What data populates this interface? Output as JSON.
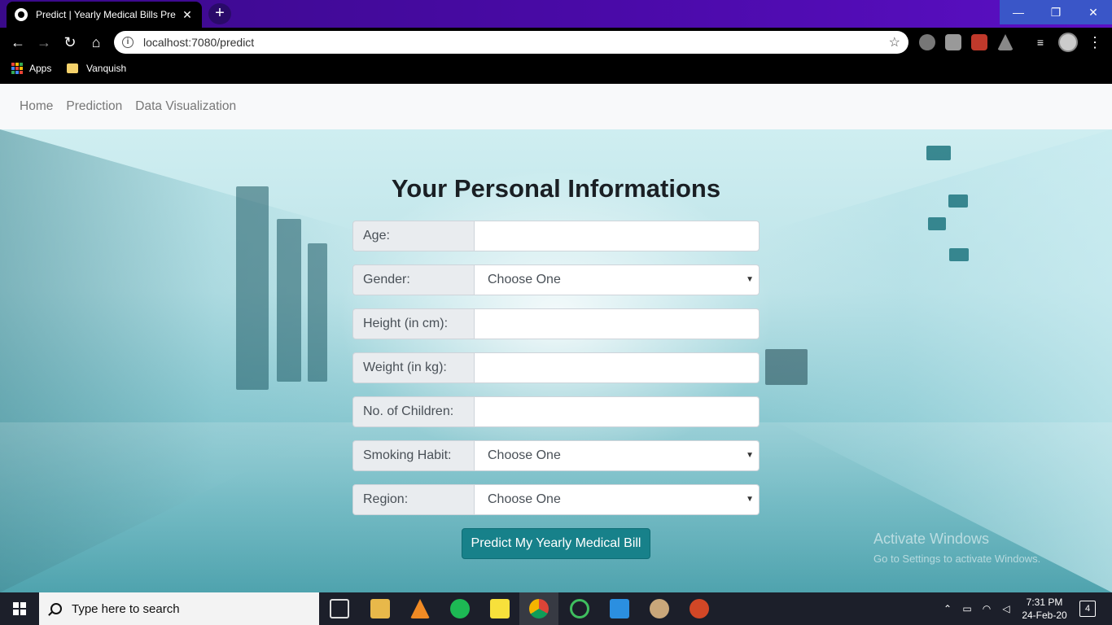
{
  "browser": {
    "tab_title": "Predict | Yearly Medical Bills Prediction",
    "new_tab_label": "+",
    "url": "localhost:7080/predict",
    "bookmarks": [
      "Apps",
      "Vanquish"
    ],
    "window_controls": {
      "minimize": "—",
      "maximize": "❐",
      "close": "✕"
    }
  },
  "navbar": {
    "items": [
      "Home",
      "Prediction",
      "Data Visualization"
    ]
  },
  "form": {
    "title": "Your Personal Informations",
    "fields": [
      {
        "label": "Age:",
        "type": "input",
        "value": ""
      },
      {
        "label": "Gender:",
        "type": "select",
        "value": "Choose One"
      },
      {
        "label": "Height (in cm):",
        "type": "input",
        "value": ""
      },
      {
        "label": "Weight (in kg):",
        "type": "input",
        "value": ""
      },
      {
        "label": "No. of Children:",
        "type": "input",
        "value": ""
      },
      {
        "label": "Smoking Habit:",
        "type": "select",
        "value": "Choose One"
      },
      {
        "label": "Region:",
        "type": "select",
        "value": "Choose One"
      }
    ],
    "submit_label": "Predict My Yearly Medical Bill"
  },
  "watermark": {
    "line1": "Activate Windows",
    "line2": "Go to Settings to activate Windows."
  },
  "taskbar": {
    "search_placeholder": "Type here to search",
    "time": "7:31 PM",
    "date": "24-Feb-20",
    "notification_count": "4"
  },
  "colors": {
    "accent_button": "#17818a",
    "titlebar": "#4a0aa8"
  }
}
